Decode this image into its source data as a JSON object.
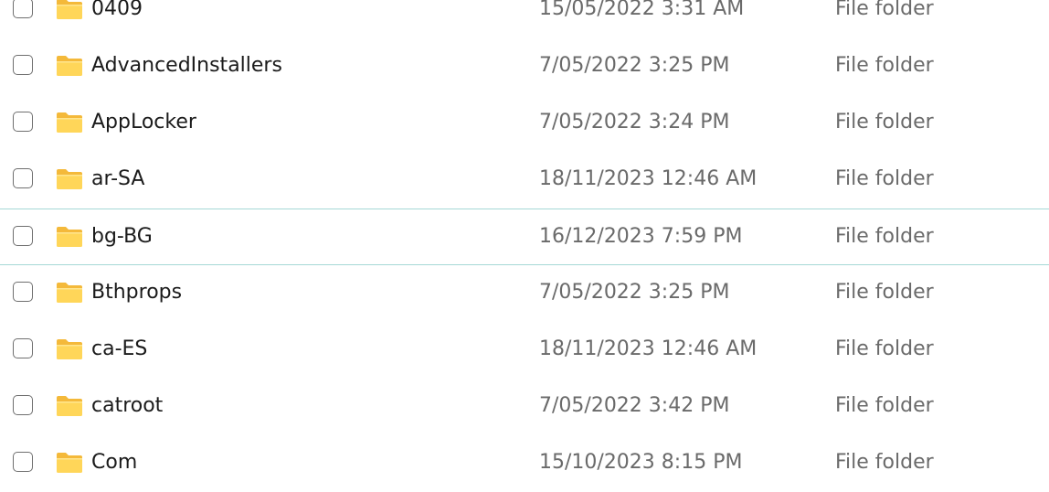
{
  "file_list": {
    "rows": [
      {
        "name": "0409",
        "date_modified": "15/05/2022 3:31 AM",
        "type": "File folder",
        "icon": "folder-icon"
      },
      {
        "name": "AdvancedInstallers",
        "date_modified": "7/05/2022 3:25 PM",
        "type": "File folder",
        "icon": "folder-icon"
      },
      {
        "name": "AppLocker",
        "date_modified": "7/05/2022 3:24 PM",
        "type": "File folder",
        "icon": "folder-icon"
      },
      {
        "name": "ar-SA",
        "date_modified": "18/11/2023 12:46 AM",
        "type": "File folder",
        "icon": "folder-icon"
      },
      {
        "name": "bg-BG",
        "date_modified": "16/12/2023 7:59 PM",
        "type": "File folder",
        "icon": "folder-icon",
        "hovered": true
      },
      {
        "name": "Bthprops",
        "date_modified": "7/05/2022 3:25 PM",
        "type": "File folder",
        "icon": "folder-icon"
      },
      {
        "name": "ca-ES",
        "date_modified": "18/11/2023 12:46 AM",
        "type": "File folder",
        "icon": "folder-icon"
      },
      {
        "name": "catroot",
        "date_modified": "7/05/2022 3:42 PM",
        "type": "File folder",
        "icon": "folder-icon"
      },
      {
        "name": "Com",
        "date_modified": "15/10/2023 8:15 PM",
        "type": "File folder",
        "icon": "folder-icon"
      }
    ]
  },
  "colors": {
    "folder_front": "#FFD659",
    "folder_back": "#F4B93A",
    "hover_border": "#A6D9D6",
    "name_text": "#1B1B1B",
    "secondary_text": "#6A6A6A"
  }
}
